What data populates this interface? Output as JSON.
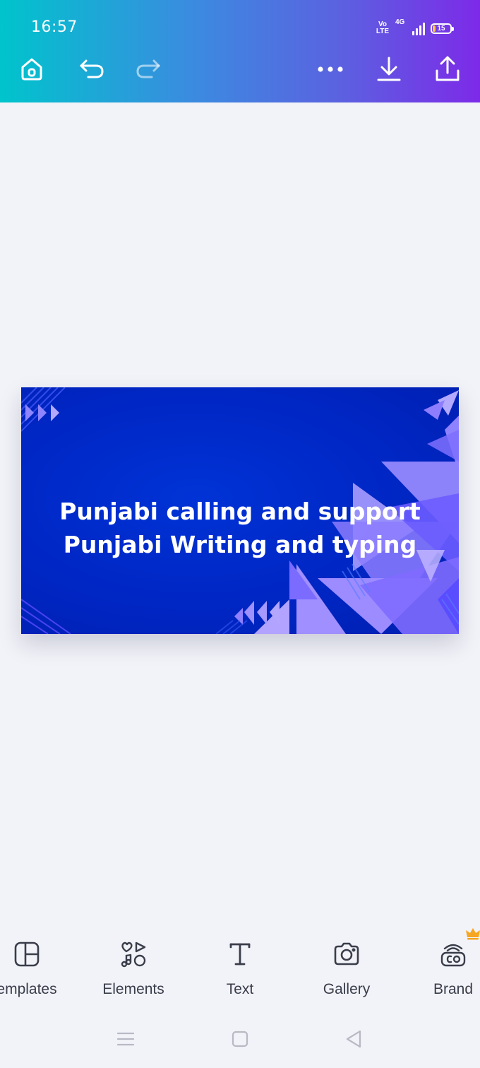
{
  "status_bar": {
    "time": "16:57",
    "volte_line1": "Vo",
    "volte_line2": "LTE",
    "network": "4G",
    "battery": "15",
    "battery_level_percent": 15
  },
  "toolbar": {
    "icons": [
      "home-icon",
      "undo-icon",
      "redo-icon",
      "more-icon",
      "download-icon",
      "share-icon"
    ]
  },
  "design": {
    "title_line1": "Punjabi calling and support",
    "title_line2": "Punjabi Writing and typing",
    "background_color": "#0029c8",
    "accent_color": "#8b7cf6"
  },
  "bottom_tools": [
    {
      "label": "emplates",
      "icon": "templates-icon"
    },
    {
      "label": "Elements",
      "icon": "elements-icon"
    },
    {
      "label": "Text",
      "icon": "text-icon"
    },
    {
      "label": "Gallery",
      "icon": "camera-icon"
    },
    {
      "label": "Brand",
      "icon": "brand-icon"
    }
  ],
  "colors": {
    "header_gradient_start": "#00c4cc",
    "header_gradient_end": "#7d2ae8",
    "canvas_background": "#f2f3f8",
    "crown": "#f5a623"
  },
  "nav_bar": {
    "icons": [
      "recents-icon",
      "home-nav-icon",
      "back-icon"
    ]
  }
}
